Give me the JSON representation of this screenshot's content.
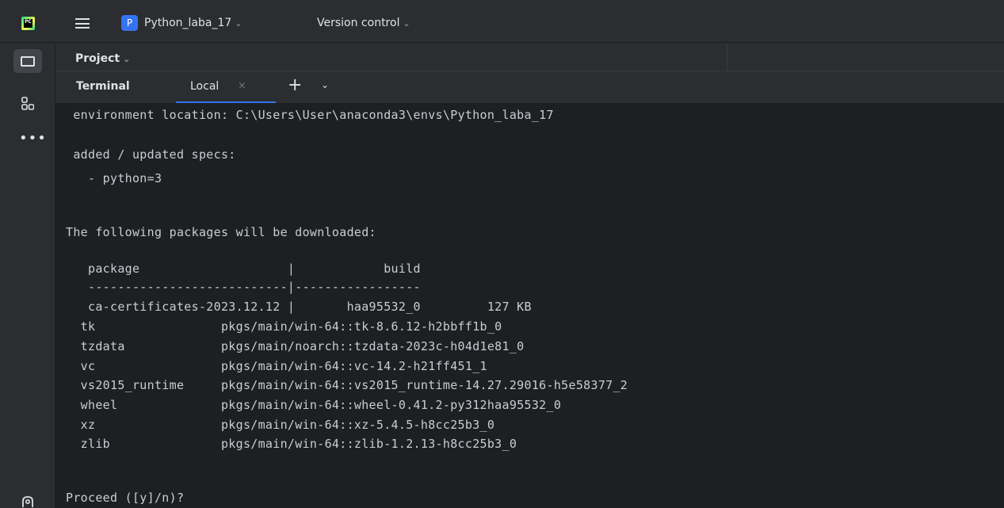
{
  "topbar": {
    "project_initial": "P",
    "project_name": "Python_laba_17",
    "vcs_label": "Version control"
  },
  "panel": {
    "title": "Project"
  },
  "terminal_tabs": {
    "title": "Terminal",
    "active_tab": "Local",
    "close_glyph": "×",
    "add_glyph": "+"
  },
  "icons": {
    "app": "pycharm-logo-icon",
    "menu": "hamburger-menu-icon",
    "project": "folder-icon",
    "structure": "structure-icon",
    "more": "more-tools-icon",
    "bottom": "python-packages-icon"
  },
  "terminal": {
    "lines": [
      " environment location: C:\\Users\\User\\anaconda3\\envs\\Python_laba_17",
      "",
      " added / updated specs:",
      "   - python=3",
      "",
      "",
      "The following packages will be downloaded:",
      "",
      "   package                    |            build",
      "   ---------------------------|-----------------",
      "   ca-certificates-2023.12.12 |       haa95532_0         127 KB",
      "  tk                 pkgs/main/win-64::tk-8.6.12-h2bbff1b_0",
      "  tzdata             pkgs/main/noarch::tzdata-2023c-h04d1e81_0",
      "  vc                 pkgs/main/win-64::vc-14.2-h21ff451_1",
      "  vs2015_runtime     pkgs/main/win-64::vs2015_runtime-14.27.29016-h5e58377_2",
      "  wheel              pkgs/main/win-64::wheel-0.41.2-py312haa95532_0",
      "  xz                 pkgs/main/win-64::xz-5.4.5-h8cc25b3_0",
      "  zlib               pkgs/main/win-64::zlib-1.2.13-h8cc25b3_0",
      "",
      "",
      "Proceed ([y]/n)?"
    ]
  },
  "colors": {
    "accent": "#3574f0",
    "background": "#1e1f22",
    "panel": "#2b2d30"
  }
}
